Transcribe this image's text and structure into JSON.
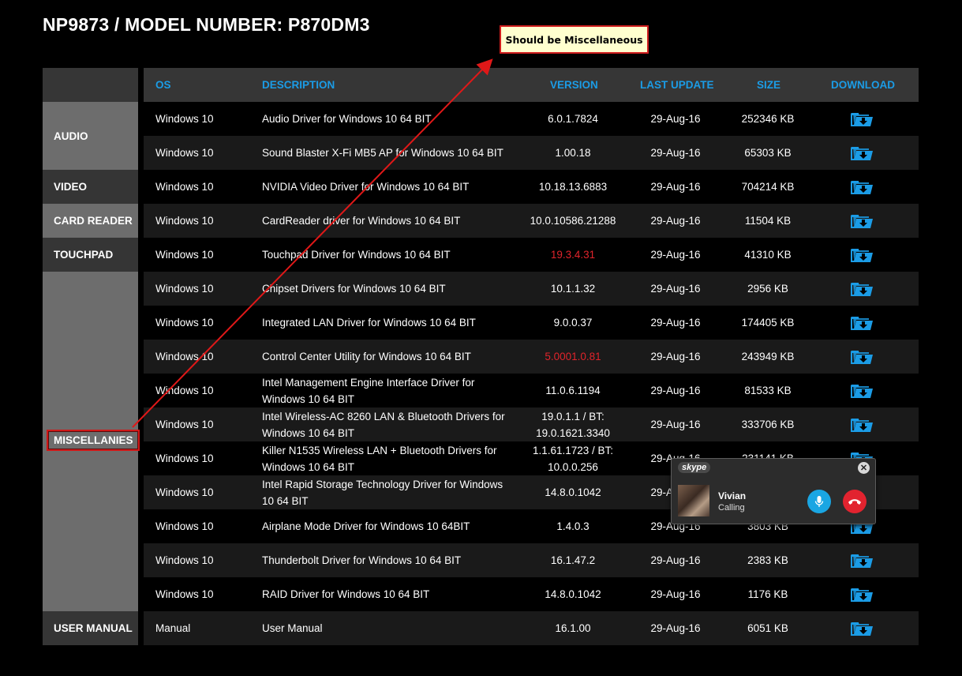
{
  "page": {
    "title": "NP9873 / MODEL NUMBER: P870DM3"
  },
  "categories": {
    "audio": "AUDIO",
    "video": "VIDEO",
    "card_reader": "CARD READER",
    "touchpad": "TOUCHPAD",
    "miscellanies": "MISCELLANIES",
    "user_manual": "USER MANUAL"
  },
  "table": {
    "headers": {
      "os": "OS",
      "description": "DESCRIPTION",
      "version": "VERSION",
      "last_update": "LAST UPDATE",
      "size": "SIZE",
      "download": "DOWNLOAD"
    },
    "rows": [
      {
        "os": "Windows 10",
        "description": "Audio Driver for Windows 10 64 BIT",
        "version": "6.0.1.7824",
        "last_update": "29-Aug-16",
        "size": "252346 KB"
      },
      {
        "os": "Windows 10",
        "description": "Sound Blaster X-Fi MB5 AP for Windows 10 64 BIT",
        "version": "1.00.18",
        "last_update": "29-Aug-16",
        "size": "65303 KB"
      },
      {
        "os": "Windows 10",
        "description": "NVIDIA Video Driver for Windows 10 64 BIT",
        "version": "10.18.13.6883",
        "last_update": "29-Aug-16",
        "size": "704214 KB"
      },
      {
        "os": "Windows 10",
        "description": "CardReader driver for Windows 10 64 BIT",
        "version": "10.0.10586.21288",
        "last_update": "29-Aug-16",
        "size": "11504 KB"
      },
      {
        "os": "Windows 10",
        "description": "Touchpad Driver for Windows 10 64 BIT",
        "version": "19.3.4.31",
        "last_update": "29-Aug-16",
        "size": "41310 KB"
      },
      {
        "os": "Windows 10",
        "description": "Chipset Drivers for Windows 10 64 BIT",
        "version": "10.1.1.32",
        "last_update": "29-Aug-16",
        "size": "2956 KB"
      },
      {
        "os": "Windows 10",
        "description": "Integrated LAN Driver for Windows 10 64 BIT",
        "version": "9.0.0.37",
        "last_update": "29-Aug-16",
        "size": "174405 KB"
      },
      {
        "os": "Windows 10",
        "description": "Control Center Utility for Windows 10 64 BIT",
        "version": "5.0001.0.81",
        "last_update": "29-Aug-16",
        "size": "243949 KB"
      },
      {
        "os": "Windows 10",
        "description": "Intel Management Engine Interface Driver for Windows 10 64 BIT",
        "version": "11.0.6.1194",
        "last_update": "29-Aug-16",
        "size": "81533 KB"
      },
      {
        "os": "Windows 10",
        "description": "Intel Wireless-AC 8260 LAN & Bluetooth Drivers for Windows 10 64 BIT",
        "version": "19.0.1.1 / BT: 19.0.1621.3340",
        "last_update": "29-Aug-16",
        "size": "333706 KB"
      },
      {
        "os": "Windows 10",
        "description": "Killer N1535 Wireless LAN + Bluetooth Drivers for Windows 10 64 BIT",
        "version": "1.1.61.1723 / BT: 10.0.0.256",
        "last_update": "29-Aug-16",
        "size": "231141 KB"
      },
      {
        "os": "Windows 10",
        "description": "Intel Rapid Storage Technology Driver for Windows 10 64 BIT",
        "version": "14.8.0.1042",
        "last_update": "29-Aug-16",
        "size": ""
      },
      {
        "os": "Windows 10",
        "description": "Airplane Mode Driver for Windows 10 64BIT",
        "version": "1.4.0.3",
        "last_update": "29-Aug-16",
        "size": "3803 KB"
      },
      {
        "os": "Windows 10",
        "description": "Thunderbolt Driver for Windows 10 64 BIT",
        "version": "16.1.47.2",
        "last_update": "29-Aug-16",
        "size": "2383 KB"
      },
      {
        "os": "Windows 10",
        "description": "RAID Driver for Windows 10 64 BIT",
        "version": "14.8.0.1042",
        "last_update": "29-Aug-16",
        "size": "1176 KB"
      },
      {
        "os": "Manual",
        "description": "User Manual",
        "version": "16.1.00",
        "last_update": "29-Aug-16",
        "size": "6051 KB"
      }
    ]
  },
  "annotation": {
    "text": "Should be Miscellaneous"
  },
  "skype": {
    "brand": "skype",
    "caller": "Vivian",
    "status": "Calling"
  },
  "colors": {
    "header_text": "#1b9ce6",
    "highlight_version": "#e0242b",
    "annotation_border": "#cf1e1e",
    "annotation_bg": "#ffffcf"
  },
  "icons": {
    "download": "folder-download-icon",
    "close": "close-icon",
    "mic": "microphone-icon",
    "hang_up": "hang-up-icon"
  }
}
